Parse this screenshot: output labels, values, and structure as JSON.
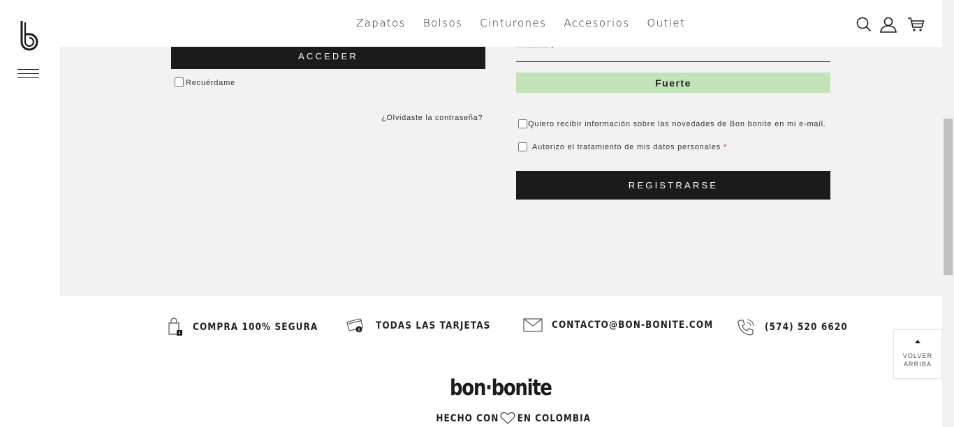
{
  "nav": {
    "items": [
      "Zapatos",
      "Bolsos",
      "Cinturones",
      "Accesorios",
      "Outlet"
    ]
  },
  "header_icons": [
    "search-icon",
    "user-icon",
    "cart-icon"
  ],
  "login": {
    "submit_label": "ACCEDER",
    "remember_label": "Recuérdame",
    "forgot_label": "¿Olvidaste la contraseña?"
  },
  "register": {
    "password_masked": "••••••••••••••",
    "strength_label": "Fuerte",
    "strength_color": "#c2e2b8",
    "newsletter_label": "Quiero recibir información sobre las novedades de Bon bonite en mi e-mail.",
    "privacy_label": "Autorizo el tratamiento de mis datos personales",
    "required_mark": "*",
    "submit_label": "REGISTRARSE"
  },
  "features": [
    {
      "icon": "secure-bag-icon",
      "label": "COMPRA 100% SEGURA"
    },
    {
      "icon": "credit-card-icon",
      "label": "TODAS LAS TARJETAS"
    },
    {
      "icon": "mail-icon",
      "label": "CONTACTO@BON-BONITE.COM"
    },
    {
      "icon": "phone-icon",
      "label": "(574) 520 6620"
    }
  ],
  "footer": {
    "brand": "bon·bonite",
    "made_prefix": "HECHO CON",
    "made_suffix": "EN COLOMBIA"
  },
  "back_to_top": {
    "line1": "VOLVER",
    "line2": "ARRIBA"
  },
  "colors": {
    "primary_dark": "#1b1b1b",
    "section_bg": "#f2f2f2",
    "whatsapp": "#1d6b5c",
    "required": "#e5332a"
  }
}
